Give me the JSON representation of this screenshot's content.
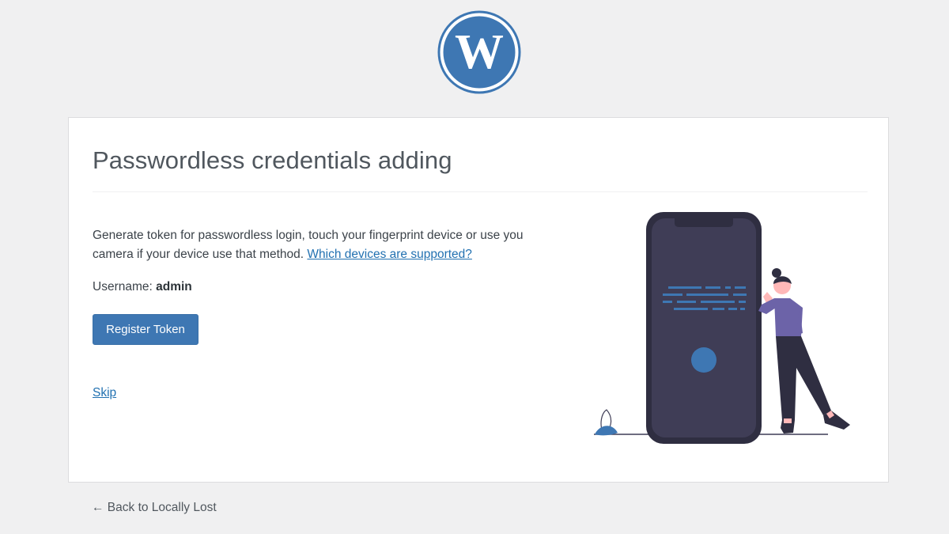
{
  "logo": {
    "name": "WordPress",
    "icon": "wordpress-logo",
    "color": "#3e77b3"
  },
  "card": {
    "title": "Passwordless credentials adding",
    "intro_text": "Generate token for passwordless login, touch your fingerprint device or use you camera if your device use that method.",
    "supported_link": "Which devices are supported?",
    "username_label": "Username:",
    "username_value": "admin",
    "register_button": "Register Token",
    "skip_link": "Skip"
  },
  "footer": {
    "back_link": "← Back to Locally Lost"
  },
  "colors": {
    "accent": "#3e77b3",
    "background": "#f0f0f1",
    "illustration_dark": "#2f2e41",
    "illustration_shirt": "#6c63a8"
  }
}
